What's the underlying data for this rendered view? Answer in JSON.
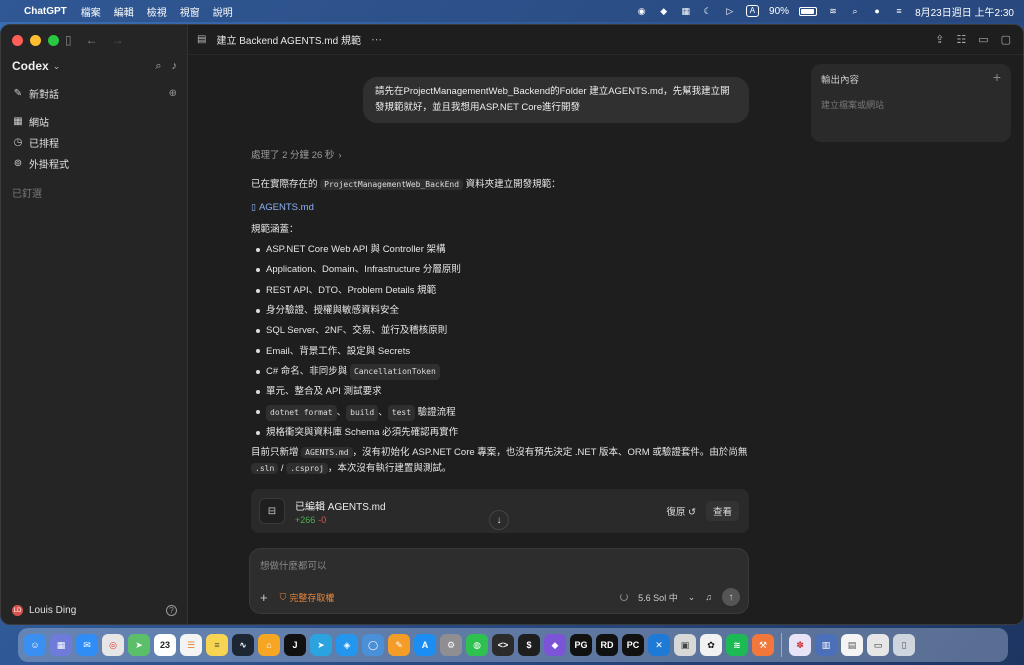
{
  "menubar": {
    "app_name": "ChatGPT",
    "menus": [
      "檔案",
      "編輯",
      "檢視",
      "視窗",
      "說明"
    ],
    "status": {
      "battery": "90%",
      "input_method": "A",
      "clock": "8月23日週日 上午2:30"
    }
  },
  "sidebar": {
    "title": "Codex",
    "new_chat": "新對話",
    "items": [
      {
        "label": "網站",
        "icon": "grid-icon"
      },
      {
        "label": "已排程",
        "icon": "clock-icon"
      },
      {
        "label": "外掛程式",
        "icon": "plug-icon"
      }
    ],
    "pinned_section": "已釘選",
    "user": {
      "name": "Louis Ding",
      "initials": "LD"
    }
  },
  "topbar": {
    "title": "建立 Backend AGENTS.md 規範"
  },
  "user_message": "請先在ProjectManagementWeb_Backend的Folder 建立AGENTS.md，先幫我建立開發規範就好，並且我想用ASP.NET Core進行開發",
  "output_panel": {
    "title": "輸出內容",
    "hint": "建立檔案或網站"
  },
  "response": {
    "processed": "處理了 2 分鐘 26 秒",
    "intro_before": "已在實際存在的",
    "intro_code": "ProjectManagementWeb_BackEnd",
    "intro_after": "資料夾建立開發規範：",
    "file_link": "AGENTS.md",
    "coverage_label": "規範涵蓋：",
    "bullets": {
      "b1": "ASP.NET Core Web API 與 Controller 架構",
      "b2": "Application、Domain、Infrastructure 分層原則",
      "b3": "REST API、DTO、Problem Details 規範",
      "b4": "身分驗證、授權與敏感資料安全",
      "b5": "SQL Server、2NF、交易、並行及稽核原則",
      "b6": "Email、背景工作、設定與 Secrets",
      "b7_text": "C# 命名、非同步與",
      "b7_code": "CancellationToken",
      "b8": "單元、整合及 API 測試要求",
      "b9_code1": "dotnet format",
      "b9_sep1": "、",
      "b9_code2": "build",
      "b9_sep2": "、",
      "b9_code3": "test",
      "b9_text": "驗證流程",
      "b10": "規格衝突與資料庫 Schema 必須先確認再實作"
    },
    "summary_p1": "目前只新增",
    "summary_code1": "AGENTS.md",
    "summary_p2": "，沒有初始化 ASP.NET Core 專案，也沒有預先決定 .NET 版本、ORM 或驗證套件。由於尚無",
    "summary_code2": ".sln",
    "summary_p3": "/",
    "summary_code3": ".csproj",
    "summary_p4": "，本次沒有執行建置與測試。"
  },
  "edit_card": {
    "title": "已編輯 AGENTS.md",
    "additions": "+266",
    "deletions": "-0",
    "undo": "復原",
    "view": "查看"
  },
  "composer": {
    "placeholder": "想做什麼都可以",
    "permission": "完整存取權",
    "model": "5.6 Sol 中"
  },
  "dock": {
    "calendar_day": "23",
    "icons": [
      "finder-icon",
      "launchpad-icon",
      "mail-icon",
      "chrome-icon",
      "maps-icon",
      "calendar-icon",
      "reminders-icon",
      "notes-icon",
      "stocks-icon",
      "home-icon",
      "jetbrains-icon",
      "telegram-icon",
      "docker-icon",
      "app-icon",
      "pencil-icon",
      "appstore-icon",
      "settings-icon",
      "line-icon",
      "dev-icon",
      "terminal-icon",
      "obsidian-icon",
      "datagrip-icon",
      "rider-icon",
      "pycharm-icon",
      "vscode-icon",
      "preview-icon",
      "chatgpt-icon",
      "spotify-icon",
      "xcode-icon",
      "photos-icon",
      "storage-icon",
      "textedit-icon",
      "window-icon",
      "trash-icon"
    ]
  }
}
